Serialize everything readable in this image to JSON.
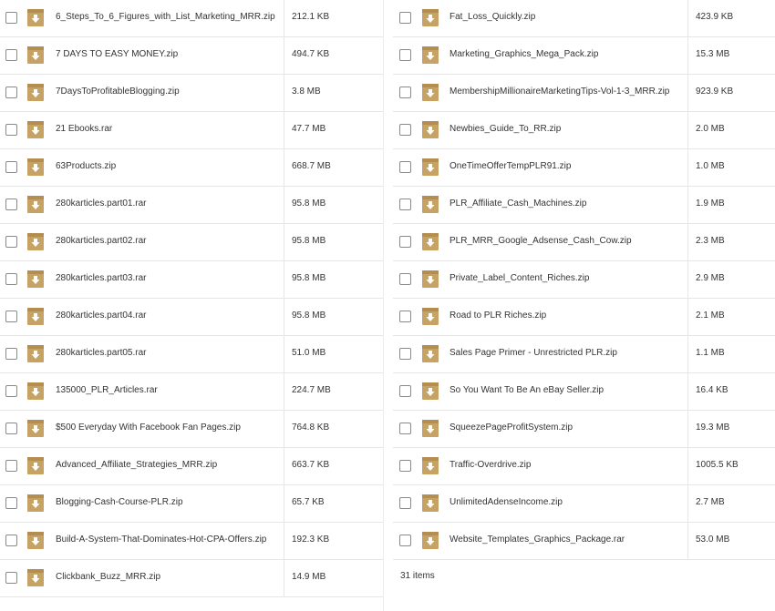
{
  "files_left": [
    {
      "name": "6_Steps_To_6_Figures_with_List_Marketing_MRR.zip",
      "size": "212.1 KB"
    },
    {
      "name": "7 DAYS TO EASY MONEY.zip",
      "size": "494.7 KB"
    },
    {
      "name": "7DaysToProfitableBlogging.zip",
      "size": "3.8 MB"
    },
    {
      "name": "21 Ebooks.rar",
      "size": "47.7 MB"
    },
    {
      "name": "63Products.zip",
      "size": "668.7 MB"
    },
    {
      "name": "280karticles.part01.rar",
      "size": "95.8 MB"
    },
    {
      "name": "280karticles.part02.rar",
      "size": "95.8 MB"
    },
    {
      "name": "280karticles.part03.rar",
      "size": "95.8 MB"
    },
    {
      "name": "280karticles.part04.rar",
      "size": "95.8 MB"
    },
    {
      "name": "280karticles.part05.rar",
      "size": "51.0 MB"
    },
    {
      "name": "135000_PLR_Articles.rar",
      "size": "224.7 MB"
    },
    {
      "name": "$500 Everyday With Facebook Fan Pages.zip",
      "size": "764.8 KB"
    },
    {
      "name": "Advanced_Affiliate_Strategies_MRR.zip",
      "size": "663.7 KB"
    },
    {
      "name": "Blogging-Cash-Course-PLR.zip",
      "size": "65.7 KB"
    },
    {
      "name": "Build-A-System-That-Dominates-Hot-CPA-Offers.zip",
      "size": "192.3 KB"
    },
    {
      "name": "Clickbank_Buzz_MRR.zip",
      "size": "14.9 MB"
    }
  ],
  "files_right": [
    {
      "name": "Fat_Loss_Quickly.zip",
      "size": "423.9 KB"
    },
    {
      "name": "Marketing_Graphics_Mega_Pack.zip",
      "size": "15.3 MB"
    },
    {
      "name": "MembershipMillionaireMarketingTips-Vol-1-3_MRR.zip",
      "size": "923.9 KB"
    },
    {
      "name": "Newbies_Guide_To_RR.zip",
      "size": "2.0 MB"
    },
    {
      "name": "OneTimeOfferTempPLR91.zip",
      "size": "1.0 MB"
    },
    {
      "name": "PLR_Affiliate_Cash_Machines.zip",
      "size": "1.9 MB"
    },
    {
      "name": "PLR_MRR_Google_Adsense_Cash_Cow.zip",
      "size": "2.3 MB"
    },
    {
      "name": "Private_Label_Content_Riches.zip",
      "size": "2.9 MB"
    },
    {
      "name": "Road to PLR Riches.zip",
      "size": "2.1 MB"
    },
    {
      "name": "Sales Page Primer - Unrestricted PLR.zip",
      "size": "1.1 MB"
    },
    {
      "name": "So You Want To Be An eBay Seller.zip",
      "size": "16.4 KB"
    },
    {
      "name": "SqueezePageProfitSystem.zip",
      "size": "19.3 MB"
    },
    {
      "name": "Traffic-Overdrive.zip",
      "size": "1005.5 KB"
    },
    {
      "name": "UnlimitedAdenseIncome.zip",
      "size": "2.7 MB"
    },
    {
      "name": "Website_Templates_Graphics_Package.rar",
      "size": "53.0 MB"
    }
  ],
  "footer": {
    "item_count": "31 items"
  },
  "icons": {
    "file": "file-download-icon",
    "checkbox": "checkbox"
  },
  "colors": {
    "file_icon": "#c7a265",
    "file_icon_top": "#b48e51",
    "row_border": "#e6e6e6"
  }
}
